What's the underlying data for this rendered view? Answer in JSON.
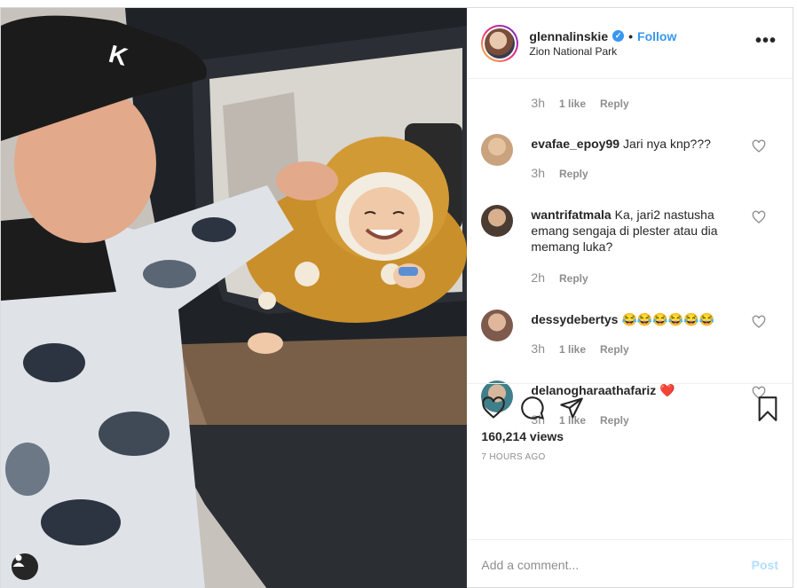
{
  "header": {
    "username": "glennalinskie",
    "verified_glyph": "✓",
    "separator": "•",
    "follow_label": "Follow",
    "location": "Zion National Park",
    "more_glyph": "•••"
  },
  "partial_comment": {
    "time": "3h",
    "likes": "1 like",
    "reply": "Reply"
  },
  "comments": [
    {
      "username": "evafae_epoy99",
      "text": "Jari nya knp???",
      "time": "3h",
      "likes": "",
      "reply": "Reply",
      "avatar_color": "#c9a27e"
    },
    {
      "username": "wantrifatmala",
      "text": "Ka, jari2 nastusha emang sengaja di plester atau dia memang luka?",
      "time": "2h",
      "likes": "",
      "reply": "Reply",
      "avatar_color": "#6b5a4e"
    },
    {
      "username": "dessydebertys",
      "text": "😂😂😂😂😂😂",
      "time": "3h",
      "likes": "1 like",
      "reply": "Reply",
      "avatar_color": "#a8766a"
    },
    {
      "username": "delanogharaathafariz",
      "text": "❤️",
      "time": "3h",
      "likes": "1 like",
      "reply": "Reply",
      "avatar_color": "#4c8f9a"
    }
  ],
  "actions": {
    "views": "160,214 views",
    "time_ago": "7 HOURS AGO"
  },
  "add_comment": {
    "placeholder": "Add a comment...",
    "post_label": "Post"
  },
  "colors": {
    "accent": "#3897f0",
    "muted": "#8e8e8e",
    "heart_red": "#ed4956"
  },
  "icons": [
    "like-icon",
    "comment-icon",
    "share-icon",
    "bookmark-icon",
    "more-options-icon",
    "verified-icon",
    "user-tag-icon"
  ]
}
